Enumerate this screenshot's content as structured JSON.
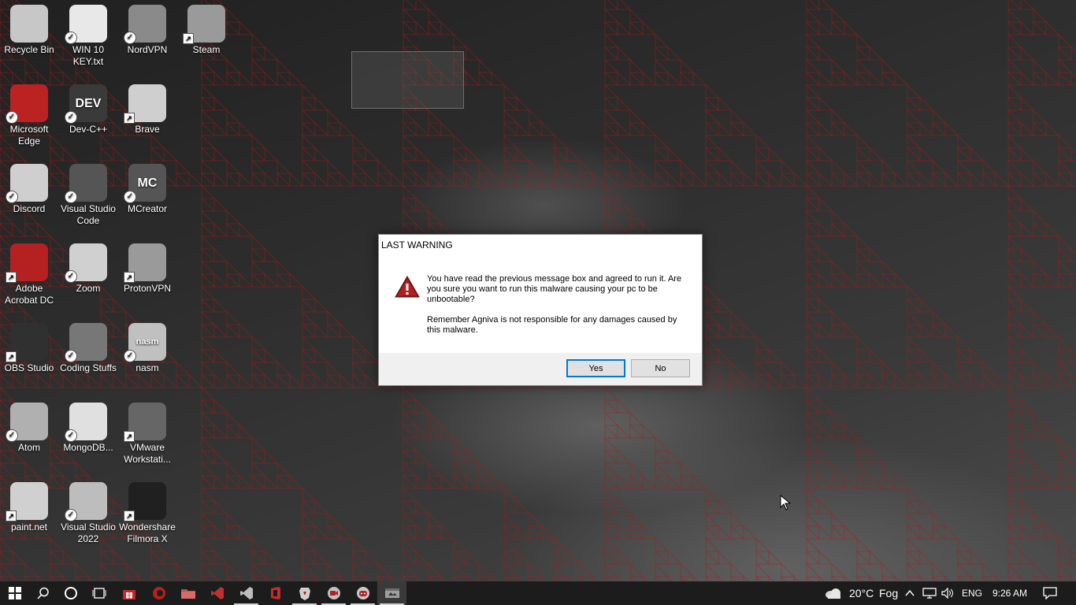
{
  "desktop": {
    "icons": [
      {
        "label": "Recycle Bin",
        "icon": "recycle-bin-icon",
        "overlay": "none"
      },
      {
        "label": "WIN 10 KEY.txt",
        "icon": "text-file-icon",
        "overlay": "check"
      },
      {
        "label": "NordVPN",
        "icon": "nordvpn-icon",
        "overlay": "check"
      },
      {
        "label": "Steam",
        "icon": "steam-icon",
        "overlay": "shortcut"
      },
      {
        "label": "Microsoft Edge",
        "icon": "edge-icon",
        "overlay": "check"
      },
      {
        "label": "Dev-C++",
        "icon": "devcpp-icon",
        "overlay": "check",
        "glyph": "DEV"
      },
      {
        "label": "Brave",
        "icon": "brave-icon",
        "overlay": "shortcut"
      },
      {
        "label": "Discord",
        "icon": "discord-icon",
        "overlay": "check"
      },
      {
        "label": "Visual Studio Code",
        "icon": "vscode-icon",
        "overlay": "check"
      },
      {
        "label": "MCreator",
        "icon": "mcreator-icon",
        "overlay": "check",
        "glyph": "MC"
      },
      {
        "label": "Adobe Acrobat DC",
        "icon": "acrobat-icon",
        "overlay": "shortcut"
      },
      {
        "label": "Zoom",
        "icon": "zoom-icon",
        "overlay": "check"
      },
      {
        "label": "ProtonVPN",
        "icon": "protonvpn-icon",
        "overlay": "shortcut"
      },
      {
        "label": "OBS Studio",
        "icon": "obs-icon",
        "overlay": "shortcut"
      },
      {
        "label": "Coding Stuffs",
        "icon": "chip-folder-icon",
        "overlay": "check"
      },
      {
        "label": "nasm",
        "icon": "nasm-icon",
        "overlay": "check",
        "glyph": "nasm"
      },
      {
        "label": "Atom",
        "icon": "atom-icon",
        "overlay": "check"
      },
      {
        "label": "MongoDB...",
        "icon": "mongodb-icon",
        "overlay": "check"
      },
      {
        "label": "VMware Workstati...",
        "icon": "vmware-icon",
        "overlay": "shortcut"
      },
      {
        "label": "paint.net",
        "icon": "paintnet-icon",
        "overlay": "shortcut"
      },
      {
        "label": "Visual Studio 2022",
        "icon": "visual-studio-icon",
        "overlay": "check"
      },
      {
        "label": "Wondershare Filmora X",
        "icon": "filmora-icon",
        "overlay": "shortcut"
      }
    ]
  },
  "dialog": {
    "title": "LAST WARNING",
    "icon": "warning-icon",
    "message_1": "You have read the previous message box and agreed to run it. Are you sure you want to run this malware causing your pc to be unbootable?",
    "message_2": "Remember Agniva is not responsible for any damages caused by this malware.",
    "yes_label": "Yes",
    "no_label": "No"
  },
  "taskbar": {
    "items": [
      {
        "name": "start-button",
        "icon": "windows-logo-icon"
      },
      {
        "name": "search-button",
        "icon": "search-icon"
      },
      {
        "name": "cortana-button",
        "icon": "cortana-circle-icon"
      },
      {
        "name": "task-view-button",
        "icon": "task-view-icon"
      },
      {
        "name": "taskbar-ms-store",
        "icon": "store-icon"
      },
      {
        "name": "taskbar-edge",
        "icon": "edge-icon"
      },
      {
        "name": "taskbar-file-explorer",
        "icon": "folder-icon"
      },
      {
        "name": "taskbar-vscode",
        "icon": "vscode-icon"
      },
      {
        "name": "taskbar-visual-studio",
        "icon": "visual-studio-icon"
      },
      {
        "name": "taskbar-office",
        "icon": "office-icon"
      },
      {
        "name": "taskbar-brave",
        "icon": "brave-icon"
      },
      {
        "name": "taskbar-zoom-like",
        "icon": "app-icon"
      },
      {
        "name": "taskbar-discord",
        "icon": "discord-icon"
      },
      {
        "name": "taskbar-running-app",
        "icon": "app-window-icon"
      }
    ],
    "weather_temp": "20°C",
    "weather_desc": "Fog",
    "language": "ENG",
    "time": "9:26 AM"
  },
  "colors": {
    "fractal_red": "#b01818",
    "taskbar_bg": "#1c1c1c",
    "dialog_footer": "#f0f0f0",
    "button_focus": "#0078d7"
  }
}
